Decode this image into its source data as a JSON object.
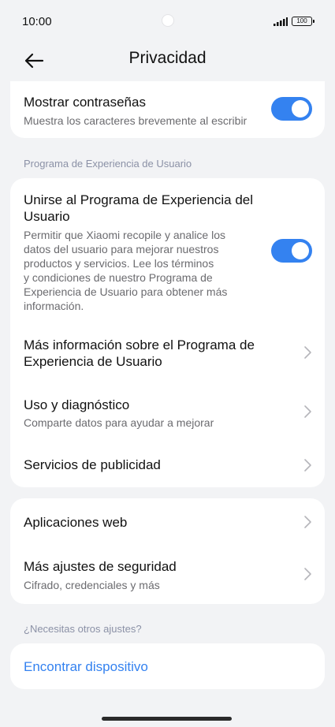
{
  "status": {
    "time": "10:00",
    "battery": "100"
  },
  "header": {
    "title": "Privacidad"
  },
  "passwords": {
    "title": "Mostrar contraseñas",
    "subtitle": "Muestra los caracteres brevemente al escribir",
    "enabled": true
  },
  "program_section": {
    "label": "Programa de Experiencia de Usuario",
    "join": {
      "title_line1": "Unirse al Programa de Experiencia del",
      "title_line2": "Usuario",
      "desc_lines": [
        "Permitir que Xiaomi recopile y analice los",
        "datos del usuario para mejorar nuestros",
        "productos y servicios. Lee los términos",
        "y condiciones de nuestro Programa de",
        "Experiencia de Usuario para obtener más",
        "información."
      ],
      "enabled": true
    },
    "more_info": {
      "title_line1": "Más información sobre el Programa de",
      "title_line2": "Experiencia de Usuario"
    },
    "usage": {
      "title": "Uso y diagnóstico",
      "subtitle": "Comparte datos para ayudar a mejorar"
    },
    "ads": {
      "title": "Servicios de publicidad"
    }
  },
  "misc": {
    "web_apps": {
      "title": "Aplicaciones web"
    },
    "more_security": {
      "title": "Más ajustes de seguridad",
      "subtitle": "Cifrado, credenciales y más"
    }
  },
  "other_section": {
    "label": "¿Necesitas otros ajustes?",
    "find_device": "Encontrar dispositivo"
  },
  "colors": {
    "accent": "#3482f0",
    "background": "#f2f3f5",
    "card": "#ffffff"
  }
}
